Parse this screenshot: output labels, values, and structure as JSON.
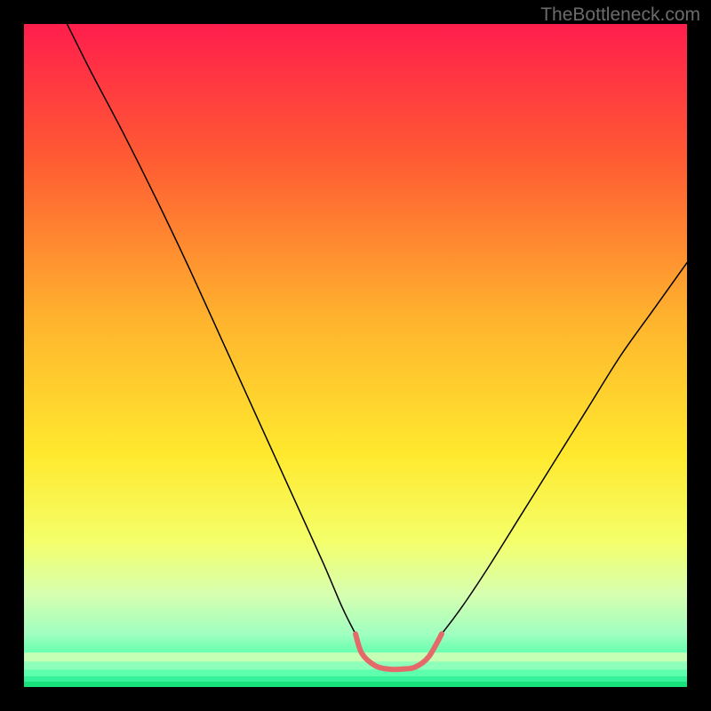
{
  "watermark": "TheBottleneck.com",
  "chart_data": {
    "type": "line",
    "title": "",
    "xlabel": "",
    "ylabel": "",
    "xlim": [
      0,
      100
    ],
    "ylim": [
      0,
      100
    ],
    "gradient_stops": [
      {
        "offset": 0,
        "color": "#ff1e4d"
      },
      {
        "offset": 20,
        "color": "#ff5a33"
      },
      {
        "offset": 45,
        "color": "#ffb52e"
      },
      {
        "offset": 65,
        "color": "#ffe92e"
      },
      {
        "offset": 78,
        "color": "#f4ff6a"
      },
      {
        "offset": 86,
        "color": "#d7ffb0"
      },
      {
        "offset": 92,
        "color": "#a0ffc0"
      },
      {
        "offset": 96,
        "color": "#4effa8"
      },
      {
        "offset": 100,
        "color": "#17e87f"
      }
    ],
    "series": [
      {
        "name": "left-arm",
        "stroke": "#000000",
        "points": [
          {
            "x": 6.5,
            "y": 100
          },
          {
            "x": 10,
            "y": 93
          },
          {
            "x": 15,
            "y": 83.5
          },
          {
            "x": 20,
            "y": 73.5
          },
          {
            "x": 25,
            "y": 63
          },
          {
            "x": 30,
            "y": 52
          },
          {
            "x": 35,
            "y": 41
          },
          {
            "x": 40,
            "y": 30
          },
          {
            "x": 45,
            "y": 19
          },
          {
            "x": 48,
            "y": 12
          },
          {
            "x": 50,
            "y": 8
          }
        ]
      },
      {
        "name": "right-arm",
        "stroke": "#000000",
        "points": [
          {
            "x": 63,
            "y": 8
          },
          {
            "x": 66,
            "y": 12
          },
          {
            "x": 70,
            "y": 18
          },
          {
            "x": 75,
            "y": 26
          },
          {
            "x": 80,
            "y": 34
          },
          {
            "x": 85,
            "y": 42
          },
          {
            "x": 90,
            "y": 50
          },
          {
            "x": 95,
            "y": 57
          },
          {
            "x": 100,
            "y": 64
          }
        ]
      },
      {
        "name": "bottom-connector",
        "stroke": "#e46a6a",
        "stroke_width": 6,
        "points": [
          {
            "x": 50,
            "y": 8
          },
          {
            "x": 51,
            "y": 5
          },
          {
            "x": 53,
            "y": 3.2
          },
          {
            "x": 55,
            "y": 2.7
          },
          {
            "x": 57,
            "y": 2.7
          },
          {
            "x": 59,
            "y": 3
          },
          {
            "x": 61,
            "y": 4.5
          },
          {
            "x": 63,
            "y": 8
          }
        ]
      }
    ],
    "bottom_bands": [
      {
        "y": 94.8,
        "h": 1.4,
        "color": "#c5ffb5"
      },
      {
        "y": 96.2,
        "h": 1.2,
        "color": "#8dffba"
      },
      {
        "y": 97.4,
        "h": 1.0,
        "color": "#5effad"
      },
      {
        "y": 98.4,
        "h": 0.8,
        "color": "#36f29a"
      },
      {
        "y": 99.2,
        "h": 0.8,
        "color": "#17e27b"
      }
    ]
  }
}
